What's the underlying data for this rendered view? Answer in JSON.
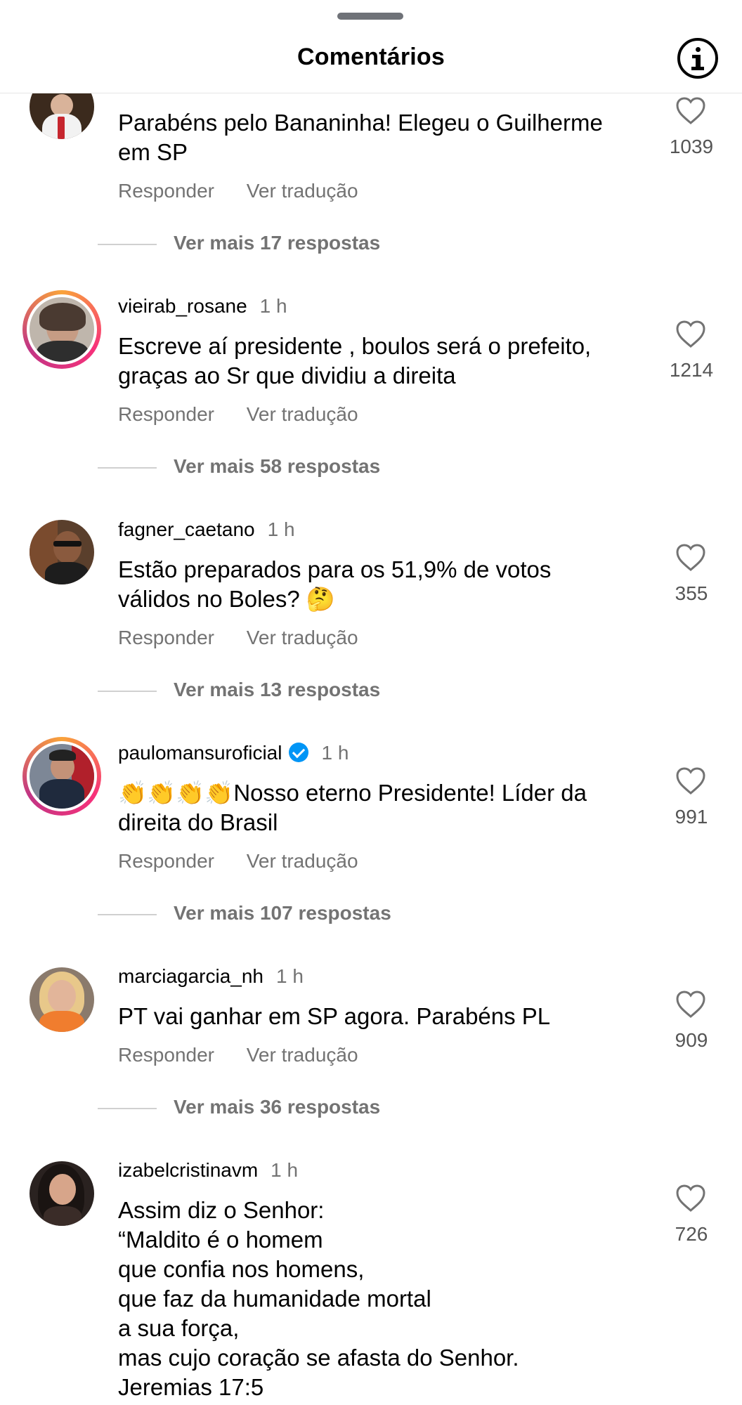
{
  "header": {
    "title": "Comentários",
    "info_icon": "info-icon"
  },
  "actions": {
    "reply": "Responder",
    "translate": "Ver tradução"
  },
  "comments": [
    {
      "username": "",
      "time": "",
      "text": "Parabéns pelo Bananinha! Elegeu o Guilherme\nem SP",
      "likes": "1039",
      "more_replies": "Ver mais 17 respostas",
      "verified": false
    },
    {
      "username": "vieirab_rosane",
      "time": "1 h",
      "text": "Escreve aí presidente , boulos será o prefeito,\ngraças ao Sr que dividiu a direita",
      "likes": "1214",
      "more_replies": "Ver mais 58 respostas",
      "verified": false
    },
    {
      "username": "fagner_caetano",
      "time": "1 h",
      "text": "Estão preparados para os 51,9% de votos\nválidos no Boles? 🤔",
      "likes": "355",
      "more_replies": "Ver mais 13 respostas",
      "verified": false
    },
    {
      "username": "paulomansuroficial",
      "time": "1 h",
      "text": "👏👏👏👏Nosso eterno Presidente! Líder da\ndireita do Brasil",
      "likes": "991",
      "more_replies": "Ver mais 107 respostas",
      "verified": true
    },
    {
      "username": "marciagarcia_nh",
      "time": "1 h",
      "text": "PT vai ganhar em SP agora. Parabéns PL",
      "likes": "909",
      "more_replies": "Ver mais 36 respostas",
      "verified": false
    },
    {
      "username": "izabelcristinavm",
      "time": "1 h",
      "text": "Assim diz o Senhor:\n“Maldito é o homem\nque confia nos homens,\nque faz da humanidade mortal\na sua força,\nmas cujo coração se afasta do Senhor.\nJeremias 17:5",
      "likes": "726",
      "more_replies": "",
      "verified": false
    }
  ]
}
